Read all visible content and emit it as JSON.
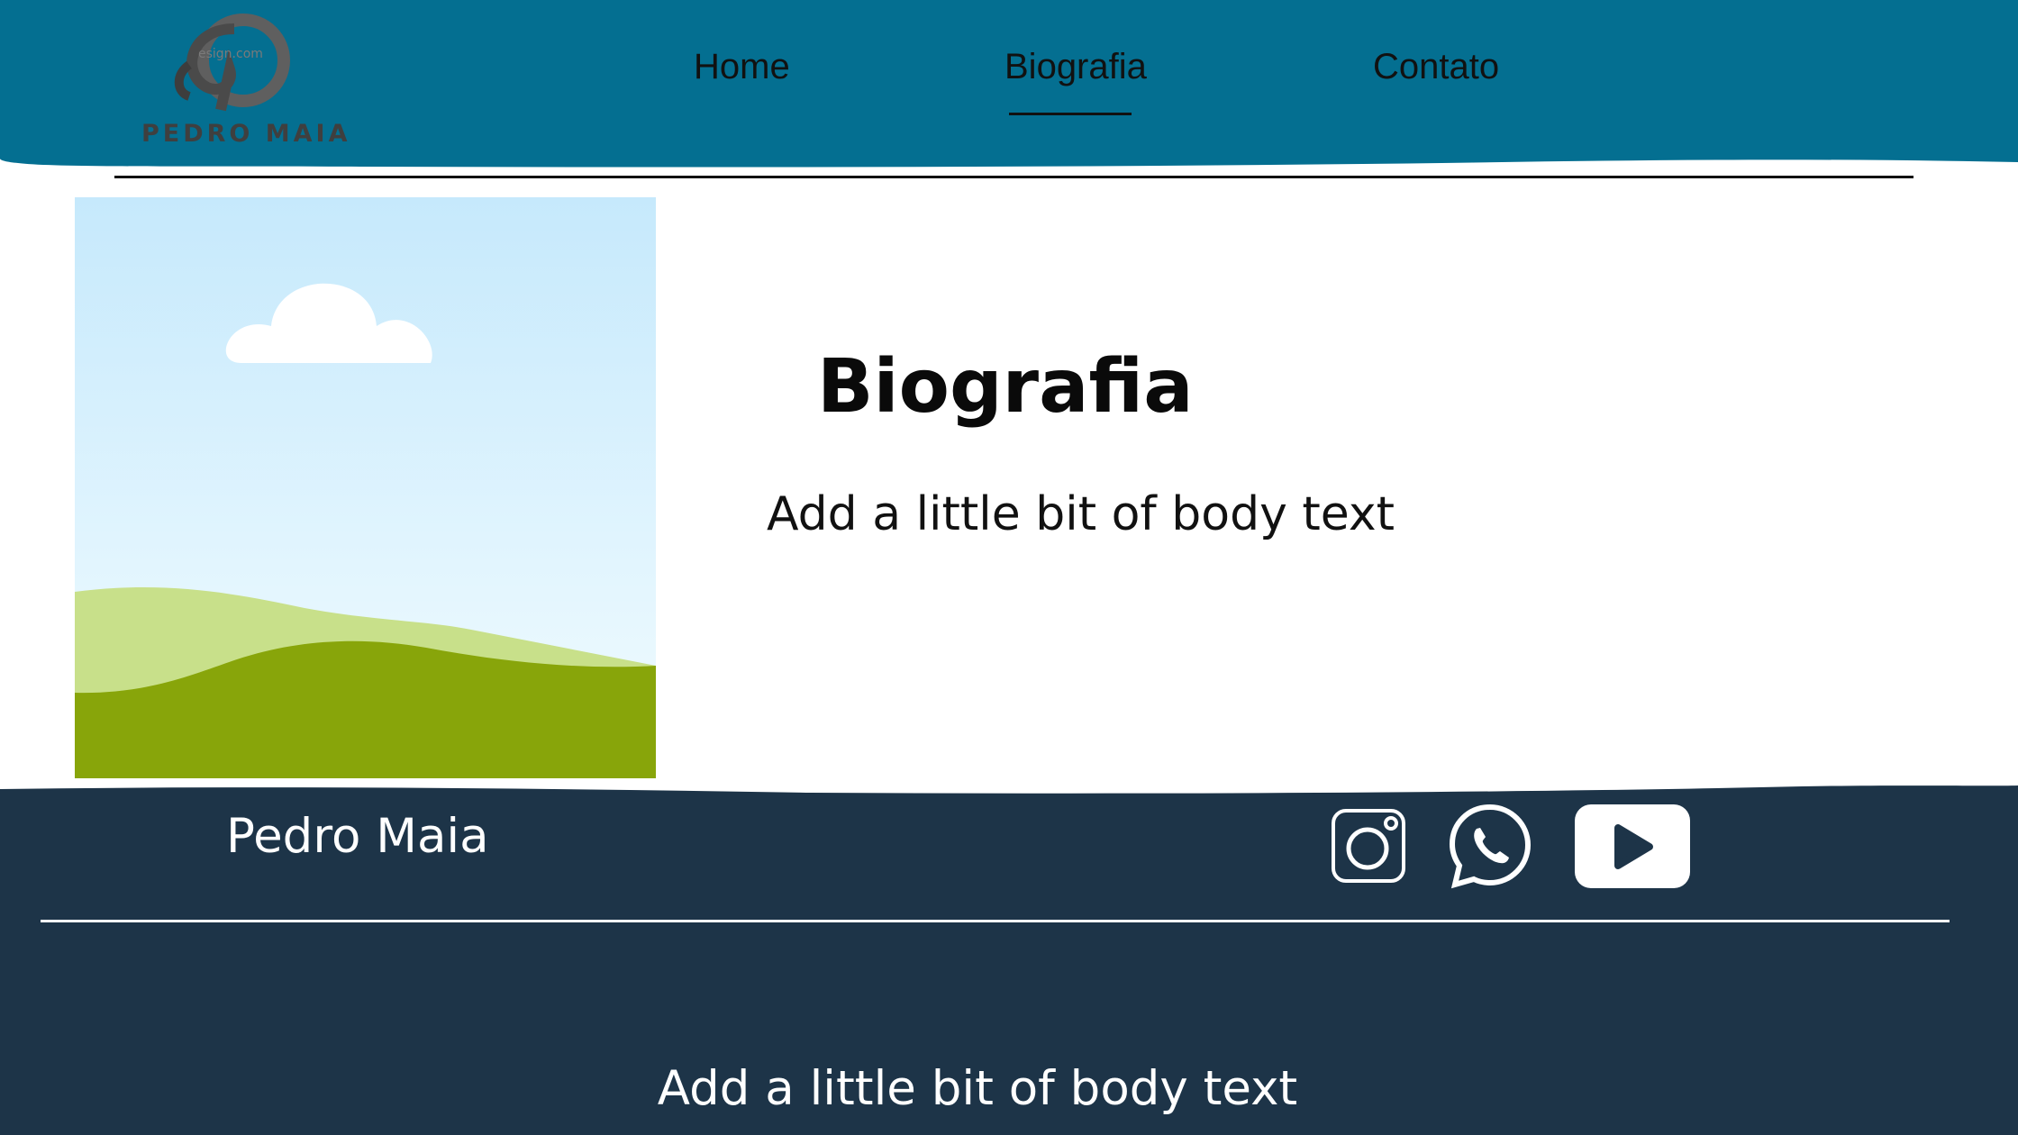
{
  "header": {
    "logo_text": "PEDRO MAIA",
    "nav": [
      {
        "label": "Home"
      },
      {
        "label": "Biografia",
        "active": true
      },
      {
        "label": "Contato"
      }
    ]
  },
  "main": {
    "title": "Biografia",
    "body": "Add a little bit of body text"
  },
  "footer": {
    "name": "Pedro Maia",
    "social_icons": [
      "instagram-icon",
      "whatsapp-icon",
      "youtube-icon"
    ],
    "body": "Add a little bit of body text"
  },
  "colors": {
    "header_bg": "#046f91",
    "footer_bg": "#1d3448",
    "sky_top": "#c6e9fc",
    "sky_bottom": "#eefaff",
    "hill_light": "#c8e08a",
    "hill_dark": "#88a50a"
  }
}
